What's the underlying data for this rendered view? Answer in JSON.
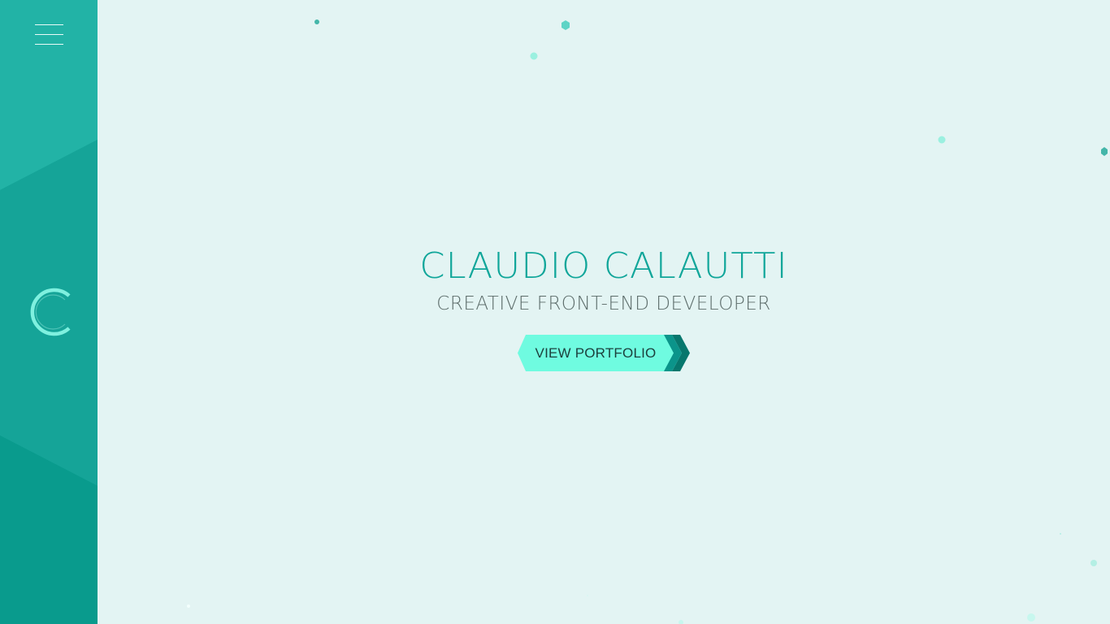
{
  "hero": {
    "name": "CLAUDIO CALAUTTI",
    "role": "CREATIVE FRONT-END DEVELOPER",
    "cta_label": "VIEW PORTFOLIO"
  },
  "sidebar": {
    "menu_icon": "hamburger-menu-icon",
    "logo_icon": "c-logo-icon"
  },
  "colors": {
    "background": "#e3f4f3",
    "sidebar": "#12a396",
    "accent": "#11a69a",
    "button": "#6ffbe0",
    "subtitle": "#5d6d6b"
  }
}
